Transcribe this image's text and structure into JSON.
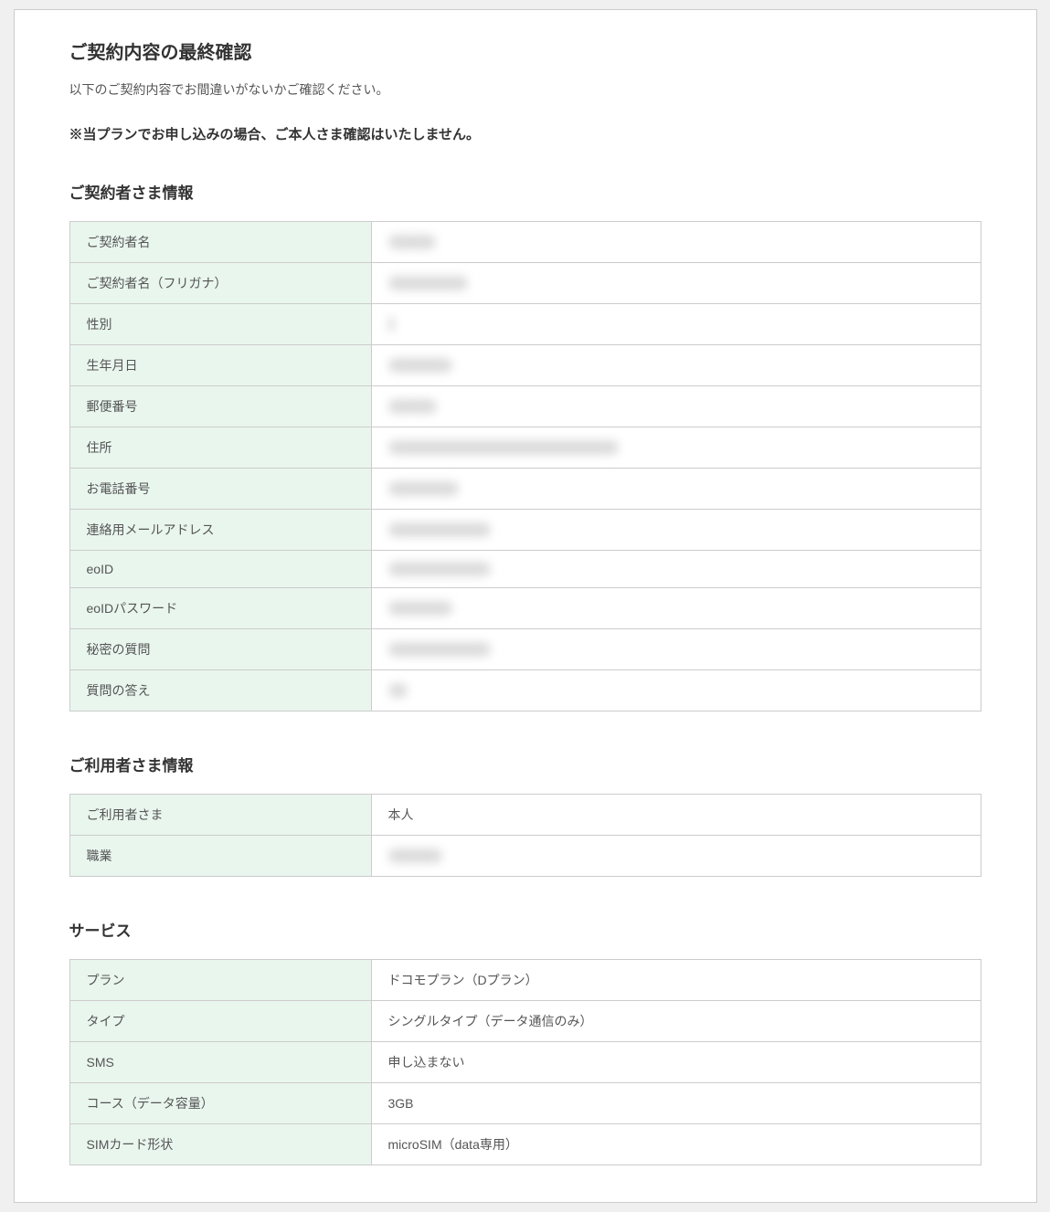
{
  "page_title": "ご契約内容の最終確認",
  "intro_text": "以下のご契約内容でお間違いがないかご確認ください。",
  "notice_text": "※当プランでお申し込みの場合、ご本人さま確認はいたしません。",
  "sections": {
    "contractor": {
      "heading": "ご契約者さま情報",
      "rows": [
        {
          "label": "ご契約者名",
          "value": "xxxx  xxx",
          "blurred": true
        },
        {
          "label": "ご契約者名（フリガナ）",
          "value": "xxxxx  xxxxxxx",
          "blurred": true
        },
        {
          "label": "性別",
          "value": "x",
          "blurred": true
        },
        {
          "label": "生年月日",
          "value": "xxxxxxxxxx",
          "blurred": true
        },
        {
          "label": "郵便番号",
          "value": "xxx-xxxx",
          "blurred": true
        },
        {
          "label": "住所",
          "value": "xxxxxxxxxxxxxxxxxxxxxxxxxxxxxxxxxxxx",
          "blurred": true
        },
        {
          "label": "お電話番号",
          "value": "xxxxxxxxxxx",
          "blurred": true
        },
        {
          "label": "連絡用メールアドレス",
          "value": "xxxxx@xxxxxxxxx",
          "blurred": true
        },
        {
          "label": "eoID",
          "value": "xxxxx@xxxxxxxxx",
          "blurred": true
        },
        {
          "label": "eoIDパスワード",
          "value": "xxxxxxxxxx",
          "blurred": true
        },
        {
          "label": "秘密の質問",
          "value": "xxxxxxxxxxxxxxxx",
          "blurred": true
        },
        {
          "label": "質問の答え",
          "value": "xxx",
          "blurred": true
        }
      ]
    },
    "user": {
      "heading": "ご利用者さま情報",
      "rows": [
        {
          "label": "ご利用者さま",
          "value": "本人",
          "blurred": false
        },
        {
          "label": "職業",
          "value": "xxxxx  xxx",
          "blurred": true
        }
      ]
    },
    "service": {
      "heading": "サービス",
      "rows": [
        {
          "label": "プラン",
          "value": "ドコモプラン（Dプラン）",
          "blurred": false
        },
        {
          "label": "タイプ",
          "value": "シングルタイプ（データ通信のみ）",
          "blurred": false
        },
        {
          "label": "SMS",
          "value": "申し込まない",
          "blurred": false
        },
        {
          "label": "コース（データ容量）",
          "value": "3GB",
          "blurred": false
        },
        {
          "label": "SIMカード形状",
          "value": "microSIM（data専用）",
          "blurred": false
        }
      ]
    }
  }
}
